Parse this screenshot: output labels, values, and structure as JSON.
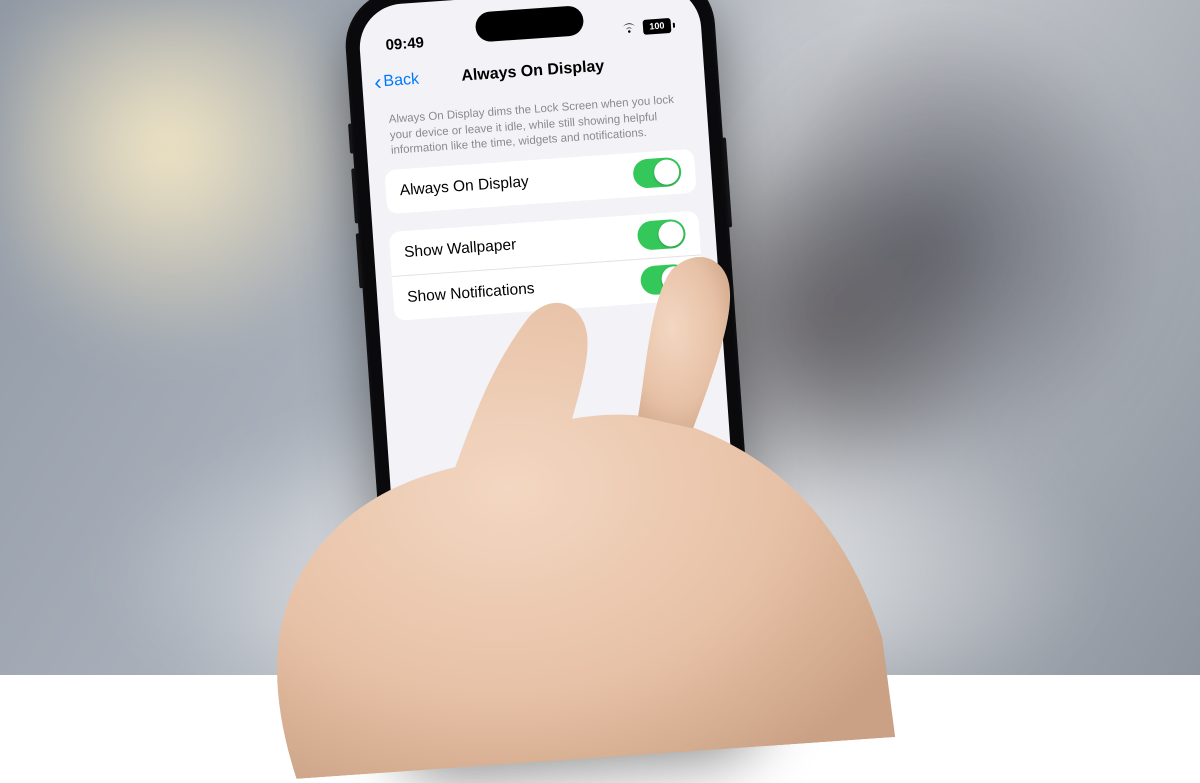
{
  "statusbar": {
    "time": "09:49",
    "battery_level": "100"
  },
  "nav": {
    "back_label": "Back",
    "title": "Always On Display"
  },
  "description": "Always On Display dims the Lock Screen when you lock your device or leave it idle, while still showing helpful information like the time, widgets and notifications.",
  "settings": {
    "always_on": {
      "label": "Always On Display",
      "on": true
    },
    "wallpaper": {
      "label": "Show Wallpaper",
      "on": true
    },
    "notifications": {
      "label": "Show Notifications",
      "on": true
    }
  }
}
